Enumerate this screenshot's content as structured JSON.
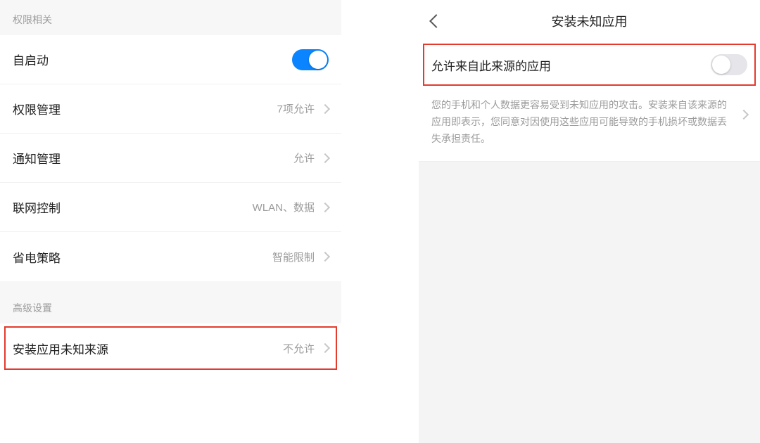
{
  "left": {
    "section_permissions": "权限相关",
    "section_advanced": "高级设置",
    "rows": {
      "autostart": {
        "label": "自启动",
        "toggle": "on"
      },
      "perm_mgmt": {
        "label": "权限管理",
        "value": "7项允许"
      },
      "notif_mgmt": {
        "label": "通知管理",
        "value": "允许"
      },
      "network_ctrl": {
        "label": "联网控制",
        "value": "WLAN、数据"
      },
      "power_policy": {
        "label": "省电策略",
        "value": "智能限制"
      },
      "install_unknown": {
        "label": "安装应用未知来源",
        "value": "不允许"
      }
    }
  },
  "right": {
    "title": "安装未知应用",
    "allow": {
      "label": "允许来自此来源的应用",
      "toggle": "off"
    },
    "desc": "您的手机和个人数据更容易受到未知应用的攻击。安装来自该来源的应用即表示，您同意对因使用这些应用可能导致的手机损坏或数据丢失承担责任。"
  }
}
